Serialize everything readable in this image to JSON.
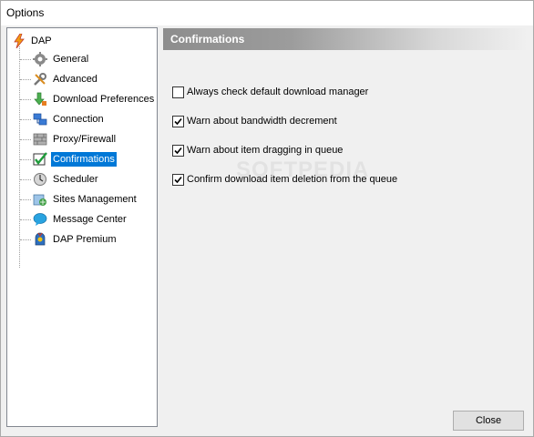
{
  "window": {
    "title": "Options"
  },
  "tree": {
    "root": {
      "label": "DAP",
      "icon": "dap-logo-icon"
    },
    "items": [
      {
        "label": "General",
        "icon": "gear-icon"
      },
      {
        "label": "Advanced",
        "icon": "tools-icon"
      },
      {
        "label": "Download Preferences",
        "icon": "download-icon"
      },
      {
        "label": "Connection",
        "icon": "connection-icon"
      },
      {
        "label": "Proxy/Firewall",
        "icon": "firewall-icon"
      },
      {
        "label": "Confirmations",
        "icon": "checkmark-icon",
        "selected": true
      },
      {
        "label": "Scheduler",
        "icon": "clock-icon"
      },
      {
        "label": "Sites Management",
        "icon": "sites-icon"
      },
      {
        "label": "Message Center",
        "icon": "chat-bubble-icon"
      },
      {
        "label": "DAP Premium",
        "icon": "premium-icon"
      }
    ]
  },
  "panel": {
    "header": "Confirmations",
    "options": [
      {
        "label": "Always check default download manager",
        "checked": false
      },
      {
        "label": "Warn about bandwidth decrement",
        "checked": true
      },
      {
        "label": "Warn about item dragging in queue",
        "checked": true
      },
      {
        "label": "Confirm download item deletion from the queue",
        "checked": true
      }
    ]
  },
  "watermark": "SOFTPEDIA",
  "buttons": {
    "close": "Close"
  },
  "colors": {
    "selection": "#0078d7",
    "header_gradient_start": "#8d8d8d"
  }
}
